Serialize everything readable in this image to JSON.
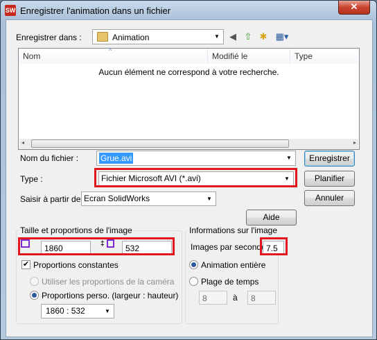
{
  "window": {
    "title": "Enregistrer l'animation dans un fichier",
    "app_icon_text": "SW",
    "close_label": "✕"
  },
  "save_in": {
    "label": "Enregistrer dans :",
    "value": "Animation"
  },
  "file_list": {
    "columns": [
      "Nom",
      "Modifié le",
      "Type"
    ],
    "empty_message": "Aucun élément ne correspond à votre recherche."
  },
  "filename": {
    "label": "Nom du fichier :",
    "value": "Grue.avi"
  },
  "type": {
    "label": "Type :",
    "value": "Fichier Microsoft AVI (*.avi)"
  },
  "capture_from": {
    "label": "Saisir à partir de:",
    "value": "Ecran SolidWorks"
  },
  "buttons": {
    "save": "Enregistrer",
    "schedule": "Planifier",
    "cancel": "Annuler",
    "help": "Aide"
  },
  "size_group": {
    "title": "Taille et proportions de l'image",
    "width": "1860",
    "height": "532",
    "keep_ratio_label": "Proportions constantes",
    "keep_ratio_checked": true,
    "camera_ratio_label": "Utiliser les proportions de la caméra",
    "custom_ratio_label": "Proportions perso. (largeur : hauteur)",
    "custom_ratio_value": "1860 : 532"
  },
  "info_group": {
    "title": "Informations sur l'image",
    "fps_label": "Images par seconde",
    "fps_value": "7.5",
    "whole_animation_label": "Animation entière",
    "time_range_label": "Plage de temps",
    "range_from": "8",
    "range_sep": "à",
    "range_to": "8"
  },
  "colors": {
    "highlight_red": "#e4141f",
    "selected_text_bg": "#3399ff"
  }
}
